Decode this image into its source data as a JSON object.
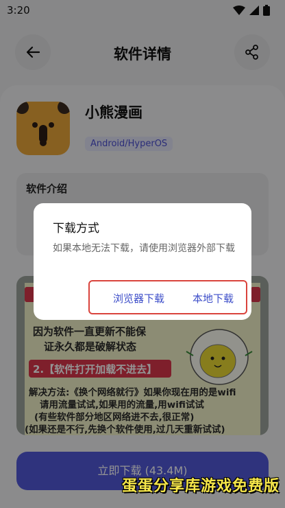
{
  "status": {
    "time": "3:20"
  },
  "header": {
    "title": "软件详情"
  },
  "app": {
    "name": "小熊漫画",
    "platform": "Android/HyperOS"
  },
  "intro": {
    "title": "软件介绍"
  },
  "promo": {
    "line1": "因为软件一直更新不能保",
    "line2": "证永久都是破解状态",
    "pill": "2.【软件打开加载不进去】",
    "line3": "解决方法:《换个网络就行》如果你现在用的是wifi",
    "line4": "请用流量试试,如果用的流量,用wifi试试",
    "line5": "(有些软件部分地区网络进不去,很正常)",
    "line6": "(如果还是不行,先换个软件使用,过几天重新试试)"
  },
  "download": {
    "label": "立即下载 (43.4M)"
  },
  "watermark": {
    "text": "蛋蛋分享库游戏免费版"
  },
  "dialog": {
    "title": "下载方式",
    "message": "如果本地无法下载，请使用浏览器外部下载",
    "browser_button": "浏览器下载",
    "local_button": "本地下载"
  },
  "colors": {
    "accent": "#5258d8",
    "highlight_border": "#d9433c",
    "app_icon_bg": "#e8a53a"
  }
}
